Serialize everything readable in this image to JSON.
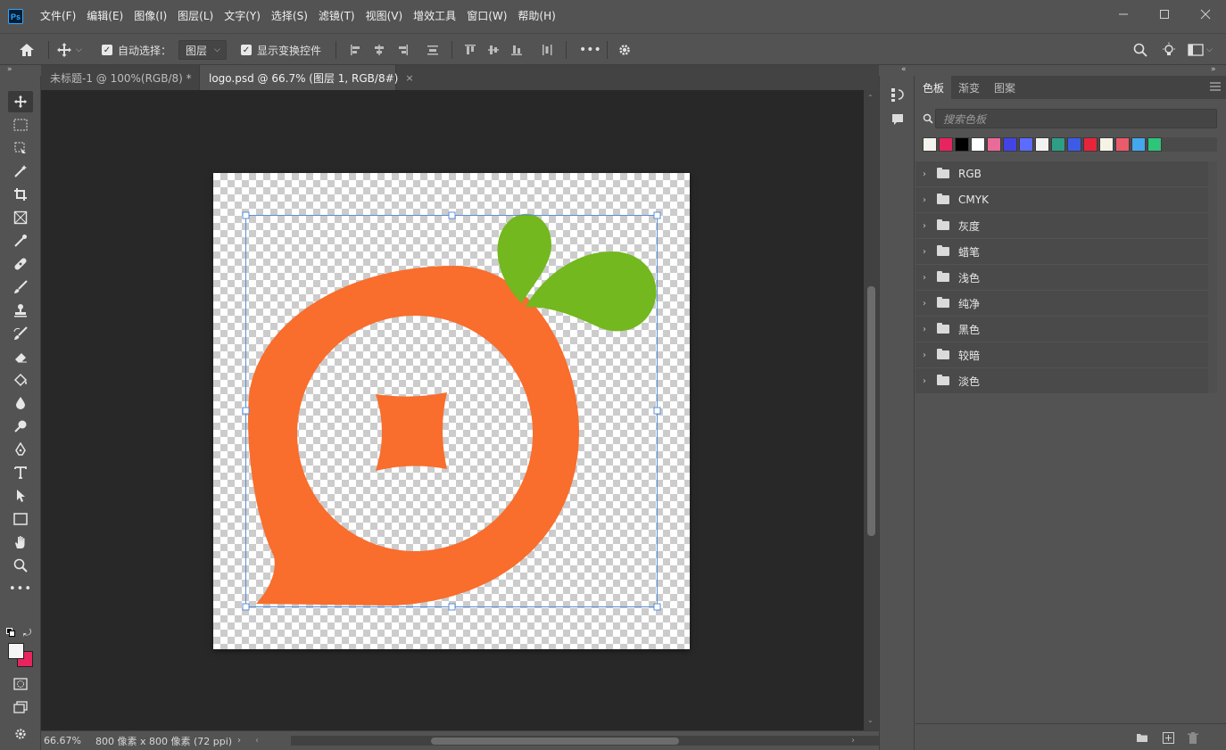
{
  "app": {
    "logo_text": "Ps",
    "menu": [
      "文件(F)",
      "编辑(E)",
      "图像(I)",
      "图层(L)",
      "文字(Y)",
      "选择(S)",
      "滤镜(T)",
      "视图(V)",
      "增效工具",
      "窗口(W)",
      "帮助(H)"
    ]
  },
  "options": {
    "auto_select_label": "自动选择：",
    "auto_select_checked": true,
    "auto_select_target": "图层",
    "show_transform_label": "显示变换控件",
    "show_transform_checked": true,
    "more_label": "•••"
  },
  "document_tabs": [
    {
      "title": "未标题-1 @ 100%(RGB/8) *",
      "active": false
    },
    {
      "title": "logo.psd @ 66.7% (图层 1, RGB/8#)",
      "active": true
    }
  ],
  "status": {
    "zoom": "66.67%",
    "doc_info": "800 像素 x 800 像素 (72 ppi)"
  },
  "artwork": {
    "orange_color": "#f96d2d",
    "leaf_color": "#72b81e"
  },
  "tools": [
    "move-tool",
    "marquee-tool",
    "lasso-tool",
    "magic-wand-tool",
    "crop-tool",
    "frame-tool",
    "eyedropper-tool",
    "healing-brush-tool",
    "brush-tool",
    "clone-stamp-tool",
    "history-brush-tool",
    "eraser-tool",
    "paint-bucket-tool",
    "blur-tool",
    "dodge-tool",
    "pen-tool",
    "type-tool",
    "path-selection-tool",
    "rectangle-tool",
    "hand-tool",
    "zoom-tool",
    "more-tools"
  ],
  "colors": {
    "foreground": "#f4f4f4",
    "background": "#e8245f"
  },
  "swatches_panel": {
    "tabs": [
      "色板",
      "渐变",
      "图案"
    ],
    "active_tab": "色板",
    "search_placeholder": "搜索色板",
    "recent_colors": [
      "#f4f4ec",
      "#e8245f",
      "#000000",
      "#ffffff",
      "#ea6a9a",
      "#4444e6",
      "#5b6cff",
      "#f2f2f2",
      "#2e9e86",
      "#3d5ce6",
      "#e8243c",
      "#f7f2e6",
      "#ea5b6b",
      "#44a8f0",
      "#2ec47a"
    ],
    "groups": [
      "RGB",
      "CMYK",
      "灰度",
      "蜡笔",
      "浅色",
      "纯净",
      "黑色",
      "较暗",
      "淡色"
    ]
  }
}
